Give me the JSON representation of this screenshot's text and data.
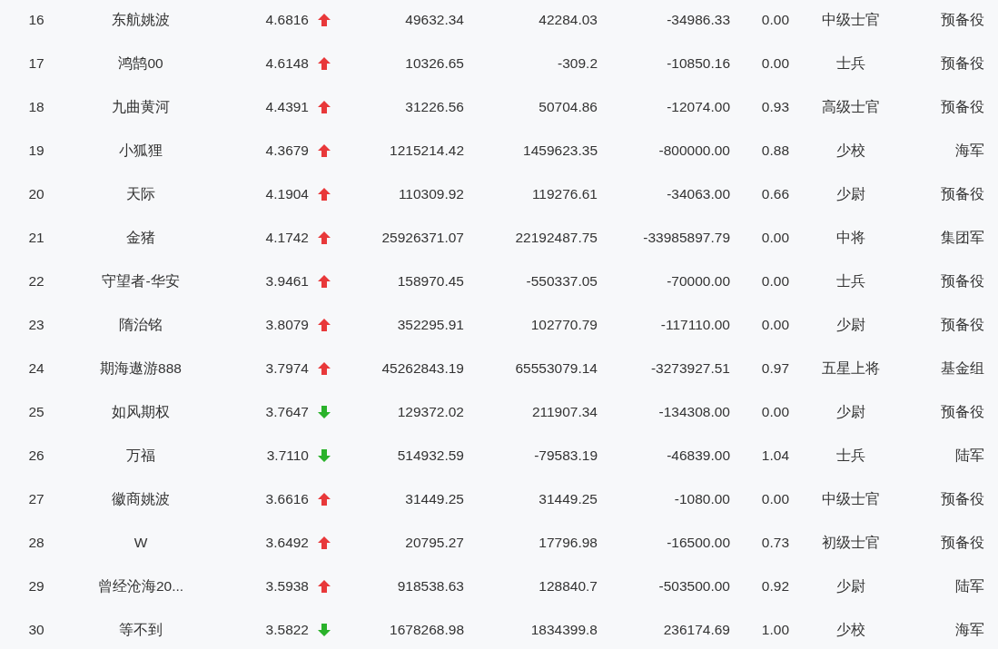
{
  "table": {
    "rows": [
      {
        "cells": [
          "16",
          "东航姚波",
          "4.6816",
          "49632.34",
          "42284.03",
          "-34986.33",
          "0.00",
          "中级士官",
          "预备役"
        ],
        "kind": "up"
      },
      {
        "cells": [
          "17",
          "鸿鹄00",
          "4.6148",
          "10326.65",
          "-309.2",
          "-10850.16",
          "0.00",
          "士兵",
          "预备役"
        ],
        "kind": "up"
      },
      {
        "cells": [
          "18",
          "九曲黄河",
          "4.4391",
          "31226.56",
          "50704.86",
          "-12074.00",
          "0.93",
          "高级士官",
          "预备役"
        ],
        "kind": "up"
      },
      {
        "cells": [
          "19",
          "小狐狸",
          "4.3679",
          "1215214.42",
          "1459623.35",
          "-800000.00",
          "0.88",
          "少校",
          "海军"
        ],
        "kind": "up"
      },
      {
        "cells": [
          "20",
          "天际",
          "4.1904",
          "110309.92",
          "119276.61",
          "-34063.00",
          "0.66",
          "少尉",
          "预备役"
        ],
        "kind": "up"
      },
      {
        "cells": [
          "21",
          "金猪",
          "4.1742",
          "25926371.07",
          "22192487.75",
          "-33985897.79",
          "0.00",
          "中将",
          "集团军"
        ],
        "kind": "up"
      },
      {
        "cells": [
          "22",
          "守望者-华安",
          "3.9461",
          "158970.45",
          "-550337.05",
          "-70000.00",
          "0.00",
          "士兵",
          "预备役"
        ],
        "kind": "up"
      },
      {
        "cells": [
          "23",
          "隋治铭",
          "3.8079",
          "352295.91",
          "102770.79",
          "-117110.00",
          "0.00",
          "少尉",
          "预备役"
        ],
        "kind": "up"
      },
      {
        "cells": [
          "24",
          "期海遨游888",
          "3.7974",
          "45262843.19",
          "65553079.14",
          "-3273927.51",
          "0.97",
          "五星上将",
          "基金组"
        ],
        "kind": "up"
      },
      {
        "cells": [
          "25",
          "如风期权",
          "3.7647",
          "129372.02",
          "211907.34",
          "-134308.00",
          "0.00",
          "少尉",
          "预备役"
        ],
        "kind": "down"
      },
      {
        "cells": [
          "26",
          "万福",
          "3.7110",
          "514932.59",
          "-79583.19",
          "-46839.00",
          "1.04",
          "士兵",
          "陆军"
        ],
        "kind": "down"
      },
      {
        "cells": [
          "27",
          "徽商姚波",
          "3.6616",
          "31449.25",
          "31449.25",
          "-1080.00",
          "0.00",
          "中级士官",
          "预备役"
        ],
        "kind": "up"
      },
      {
        "cells": [
          "28",
          "W",
          "3.6492",
          "20795.27",
          "17796.98",
          "-16500.00",
          "0.73",
          "初级士官",
          "预备役"
        ],
        "kind": "up"
      },
      {
        "cells": [
          "29",
          "曾经沧海20...",
          "3.5938",
          "918538.63",
          "128840.7",
          "-503500.00",
          "0.92",
          "少尉",
          "陆军"
        ],
        "kind": "up"
      },
      {
        "cells": [
          "30",
          "等不到",
          "3.5822",
          "1678268.98",
          "1834399.8",
          "236174.69",
          "1.00",
          "少校",
          "海军"
        ],
        "kind": "down"
      }
    ]
  }
}
